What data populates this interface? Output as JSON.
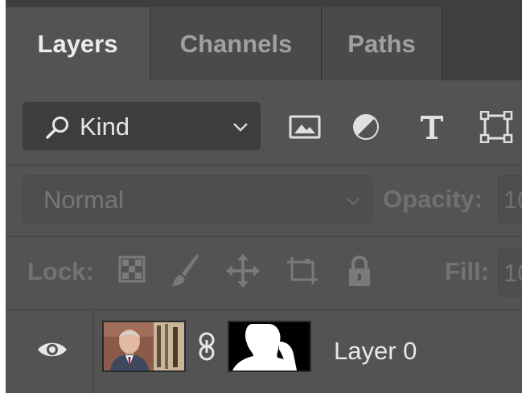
{
  "tabs": [
    {
      "label": "Layers",
      "active": true
    },
    {
      "label": "Channels",
      "active": false
    },
    {
      "label": "Paths",
      "active": false
    }
  ],
  "filter": {
    "kind_label": "Kind",
    "icons": [
      "image-filter-icon",
      "adjustment-filter-icon",
      "type-filter-icon",
      "shape-filter-icon"
    ]
  },
  "blend": {
    "mode": "Normal",
    "opacity_label": "Opacity:",
    "opacity_value": "10"
  },
  "lock": {
    "label": "Lock:",
    "icons": [
      "lock-transparent-pixels-icon",
      "lock-image-pixels-icon",
      "lock-position-icon",
      "lock-artboard-icon",
      "lock-all-icon"
    ],
    "fill_label": "Fill:",
    "fill_value": "10"
  },
  "layer": {
    "name": "Layer 0",
    "visible": true
  },
  "colors": {
    "panel_bg": "#535353",
    "tabbar_bg": "#3f3f3f",
    "text_active": "#ececec",
    "text_dim": "#737373"
  }
}
